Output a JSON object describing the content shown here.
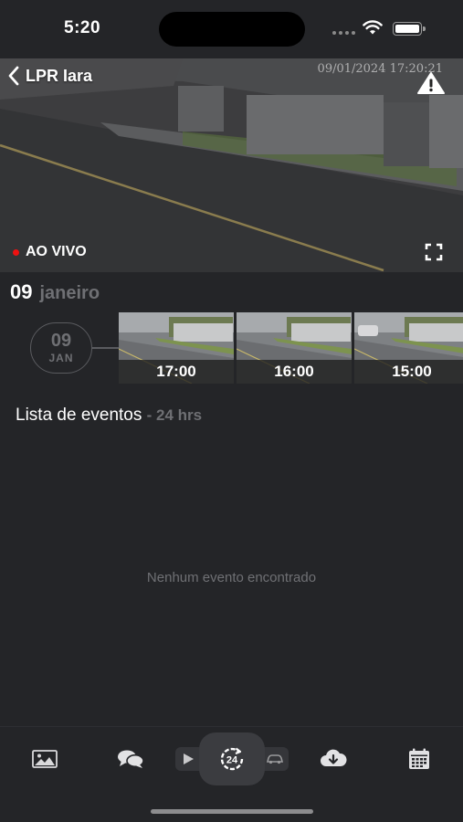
{
  "status_bar": {
    "time": "5:20"
  },
  "video": {
    "title": "LPR Iara",
    "timestamp": "09/01/2024 17:20:21",
    "live_label": "AO VIVO"
  },
  "date_header": {
    "day": "09",
    "month": "janeiro"
  },
  "timeline": {
    "day": "09",
    "month_short": "JAN",
    "thumbnails": [
      {
        "label": "17:00"
      },
      {
        "label": "16:00"
      },
      {
        "label": "15:00"
      }
    ]
  },
  "events": {
    "title": "Lista de eventos",
    "range": "- 24 hrs",
    "empty_message": "Nenhum evento encontrado"
  },
  "bottom_nav": {
    "items": [
      "image-icon",
      "chat-icon",
      "play-icon",
      "24h-icon",
      "car-icon",
      "cloud-download-icon",
      "calendar-icon"
    ]
  },
  "colors": {
    "background": "#242528",
    "muted_text": "#6f7074",
    "live_dot": "#ee1111"
  }
}
